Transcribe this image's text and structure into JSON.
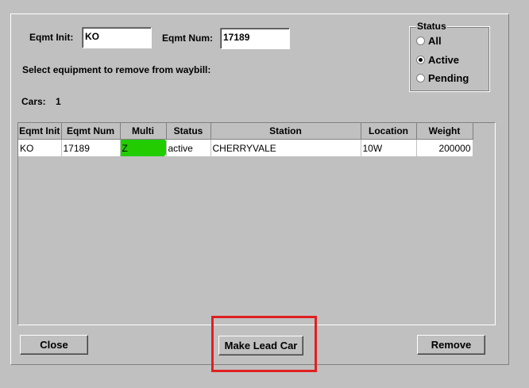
{
  "fields": {
    "eqmt_init_label": "Eqmt Init:",
    "eqmt_init_value": "KO",
    "eqmt_num_label": "Eqmt Num:",
    "eqmt_num_value": "17189"
  },
  "instruction": "Select equipment to remove from waybill:",
  "cars": {
    "label": "Cars:",
    "count": "1"
  },
  "status": {
    "title": "Status",
    "options": [
      {
        "label": "All",
        "selected": false
      },
      {
        "label": "Active",
        "selected": true
      },
      {
        "label": "Pending",
        "selected": false
      }
    ]
  },
  "table": {
    "columns": [
      "Eqmt Init",
      "Eqmt Num",
      "Multi",
      "Status",
      "Station",
      "Location",
      "Weight"
    ],
    "rows": [
      [
        "KO",
        "17189",
        "Z",
        "active",
        "CHERRYVALE",
        "10W",
        "200000"
      ]
    ]
  },
  "buttons": {
    "close": "Close",
    "make_lead_car": "Make Lead Car",
    "remove": "Remove"
  },
  "colors": {
    "highlight": "#22cc00",
    "annotation_box": "#e02020"
  }
}
